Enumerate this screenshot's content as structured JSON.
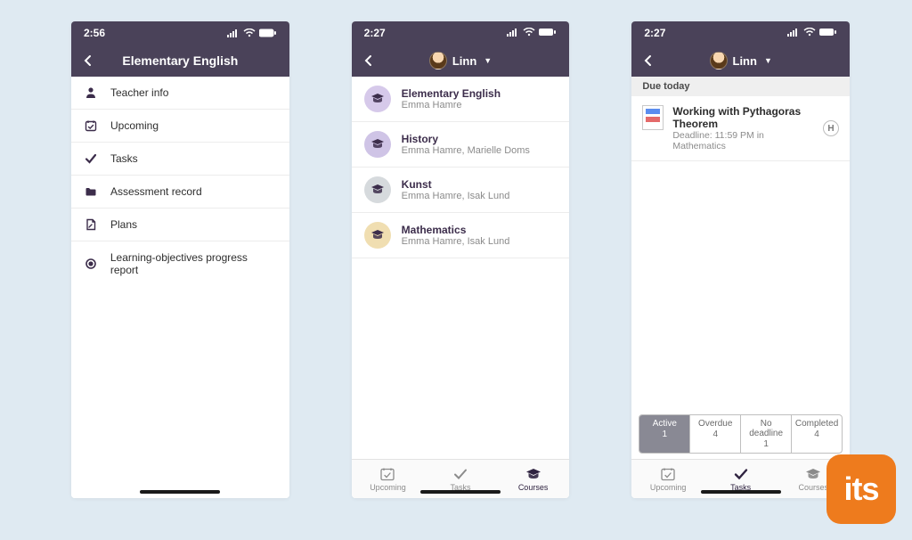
{
  "brand": {
    "label": "its",
    "color": "#ee7b1d"
  },
  "screen1": {
    "time": "2:56",
    "title": "Elementary English",
    "menu": [
      {
        "icon": "person-icon",
        "label": "Teacher info"
      },
      {
        "icon": "calendar-check-icon",
        "label": "Upcoming"
      },
      {
        "icon": "checkmark-icon",
        "label": "Tasks"
      },
      {
        "icon": "folder-icon",
        "label": "Assessment record"
      },
      {
        "icon": "document-icon",
        "label": "Plans"
      },
      {
        "icon": "target-icon",
        "label": "Learning-objectives progress report"
      }
    ]
  },
  "screen2": {
    "time": "2:27",
    "user": "Linn",
    "courses": [
      {
        "name": "Elementary English",
        "sub": "Emma Hamre",
        "color": "#d6c9ea"
      },
      {
        "name": "History",
        "sub": "Emma Hamre, Marielle Doms",
        "color": "#cfc4e6"
      },
      {
        "name": "Kunst",
        "sub": "Emma Hamre, Isak Lund",
        "color": "#d6dadd"
      },
      {
        "name": "Mathematics",
        "sub": "Emma Hamre, Isak Lund",
        "color": "#f0deb1"
      }
    ],
    "tabs": {
      "upcoming": "Upcoming",
      "tasks": "Tasks",
      "courses": "Courses",
      "active": "courses"
    }
  },
  "screen3": {
    "time": "2:27",
    "user": "Linn",
    "sectionHeader": "Due today",
    "task": {
      "title": "Working with Pythagoras Theorem",
      "sub": "Deadline: 11:59 PM in Mathematics",
      "badge": "H"
    },
    "filters": [
      {
        "name": "Active",
        "count": "1",
        "active": true
      },
      {
        "name": "Overdue",
        "count": "4",
        "active": false
      },
      {
        "name": "No deadline",
        "count": "1",
        "active": false
      },
      {
        "name": "Completed",
        "count": "4",
        "active": false
      }
    ],
    "tabs": {
      "upcoming": "Upcoming",
      "tasks": "Tasks",
      "courses": "Courses",
      "active": "tasks"
    }
  }
}
